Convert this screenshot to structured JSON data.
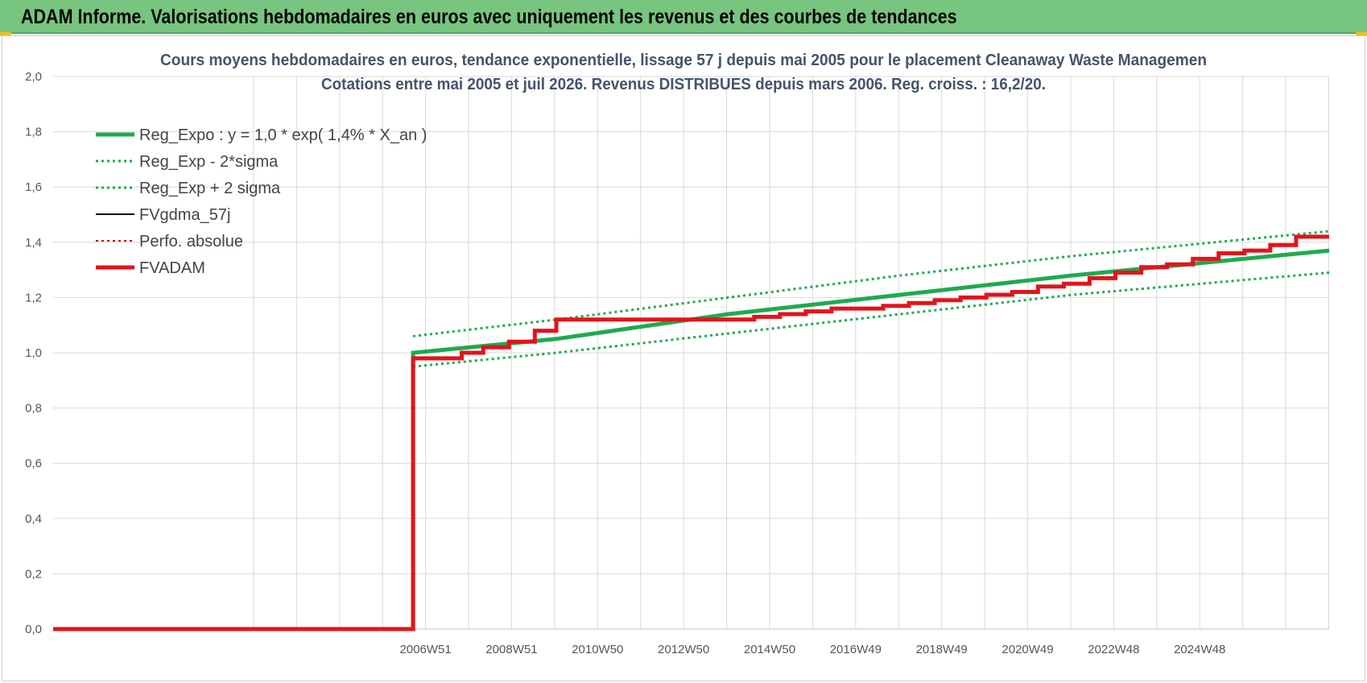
{
  "header": {
    "title": "ADAM Informe. Valorisations hebdomadaires en euros avec uniquement les revenus et des courbes de tendances"
  },
  "colors": {
    "header_bg": "#77c57e",
    "green": "#1faa4f",
    "red": "#e3131b",
    "black": "#000000",
    "dark_red": "#c00000",
    "grid": "#d9d9d9"
  },
  "chart_data": {
    "type": "line",
    "title_lines": [
      "Cours moyens hebdomadaires en euros, tendance exponentielle, lissage 57 j depuis mai 2005 pour le placement Cleanaway Waste Managemen",
      "Cotations entre mai 2005 et juil 2026. Revenus DISTRIBUES depuis mars 2006. Reg. croiss. : 16,2/20."
    ],
    "xlabel": "",
    "ylabel": "",
    "x_range": [
      1998.3,
      2027.97
    ],
    "ylim": [
      0,
      2
    ],
    "grid": true,
    "legend_position": "top-left",
    "y_ticks": [
      "0,0",
      "0,2",
      "0,4",
      "0,6",
      "0,8",
      "1,0",
      "1,2",
      "1,4",
      "1,6",
      "1,8",
      "2,0"
    ],
    "x_ticks": [
      {
        "label": "2006W51",
        "x": 2006.96
      },
      {
        "label": "2008W51",
        "x": 2008.96
      },
      {
        "label": "2010W50",
        "x": 2010.96
      },
      {
        "label": "2012W50",
        "x": 2012.96
      },
      {
        "label": "2014W50",
        "x": 2014.96
      },
      {
        "label": "2016W49",
        "x": 2016.96
      },
      {
        "label": "2018W49",
        "x": 2018.96
      },
      {
        "label": "2020W49",
        "x": 2020.96
      },
      {
        "label": "2022W48",
        "x": 2022.96
      },
      {
        "label": "2024W48",
        "x": 2024.96
      }
    ],
    "series": [
      {
        "name": "Reg_Expo : y = 1,0 * exp( 1,4% *  X_an )",
        "color": "#1faa4f",
        "style": "solid",
        "width": 5,
        "x": [
          1998.3,
          2006.67,
          2006.67,
          2010,
          2014,
          2018,
          2022,
          2027.97
        ],
        "y": [
          0,
          0,
          1.0,
          1.05,
          1.14,
          1.21,
          1.28,
          1.37
        ]
      },
      {
        "name": "Reg_Exp - 2*sigma",
        "color": "#1faa4f",
        "style": "dotted",
        "width": 3,
        "x": [
          2006.67,
          2010,
          2014,
          2018,
          2022,
          2027.97
        ],
        "y": [
          0.95,
          1.0,
          1.07,
          1.14,
          1.21,
          1.29
        ]
      },
      {
        "name": "Reg_Exp + 2 sigma",
        "color": "#1faa4f",
        "style": "dotted",
        "width": 3,
        "x": [
          2006.67,
          2010,
          2014,
          2018,
          2022,
          2027.97
        ],
        "y": [
          1.06,
          1.12,
          1.2,
          1.28,
          1.35,
          1.44
        ]
      },
      {
        "name": "FVgdma_57j",
        "color": "#000000",
        "style": "solid",
        "width": 2,
        "x": [
          1998.3,
          2006.67,
          2006.67,
          2007.2,
          2007.8,
          2008.3,
          2008.9,
          2009.5,
          2010.0,
          2012.0,
          2014.0,
          2014.6,
          2015.2,
          2015.8,
          2016.4,
          2017.0,
          2017.6,
          2018.2,
          2018.8,
          2019.4,
          2020.0,
          2020.6,
          2021.2,
          2021.8,
          2022.4,
          2023.0,
          2023.6,
          2024.2,
          2024.8,
          2025.4,
          2026.0,
          2026.6,
          2027.2,
          2027.97
        ],
        "y": [
          0,
          0,
          0.98,
          0.98,
          1.0,
          1.02,
          1.04,
          1.08,
          1.12,
          1.12,
          1.12,
          1.13,
          1.14,
          1.15,
          1.16,
          1.16,
          1.17,
          1.18,
          1.19,
          1.2,
          1.21,
          1.22,
          1.24,
          1.25,
          1.27,
          1.29,
          1.31,
          1.32,
          1.34,
          1.36,
          1.37,
          1.39,
          1.42,
          1.42
        ]
      },
      {
        "name": "Perfo. absolue",
        "color": "#c00000",
        "style": "dotted",
        "width": 2,
        "x": [],
        "y": []
      },
      {
        "name": "FVADAM",
        "color": "#e3131b",
        "style": "solid",
        "width": 5,
        "x": [
          1998.3,
          2006.67,
          2006.67,
          2007.2,
          2007.8,
          2008.3,
          2008.9,
          2009.5,
          2010.0,
          2012.0,
          2014.0,
          2014.6,
          2015.2,
          2015.8,
          2016.4,
          2017.0,
          2017.6,
          2018.2,
          2018.8,
          2019.4,
          2020.0,
          2020.6,
          2021.2,
          2021.8,
          2022.4,
          2023.0,
          2023.6,
          2024.2,
          2024.8,
          2025.4,
          2026.0,
          2026.6,
          2027.2,
          2027.97
        ],
        "y": [
          0,
          0,
          0.98,
          0.98,
          1.0,
          1.02,
          1.04,
          1.08,
          1.12,
          1.12,
          1.12,
          1.13,
          1.14,
          1.15,
          1.16,
          1.16,
          1.17,
          1.18,
          1.19,
          1.2,
          1.21,
          1.22,
          1.24,
          1.25,
          1.27,
          1.29,
          1.31,
          1.32,
          1.34,
          1.36,
          1.37,
          1.39,
          1.42,
          1.42
        ]
      }
    ]
  }
}
